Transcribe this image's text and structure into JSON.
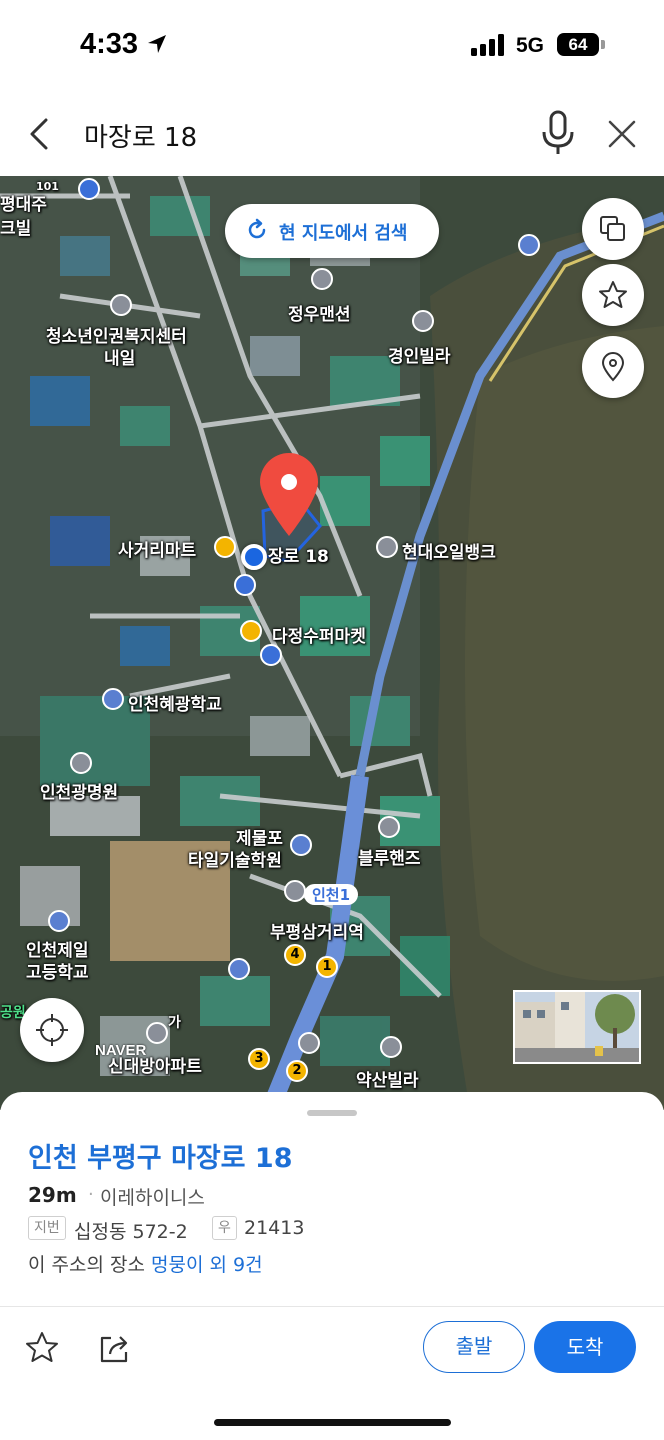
{
  "status_bar": {
    "time": "4:33",
    "network": "5G",
    "battery": "64"
  },
  "search": {
    "query": "마장로 18"
  },
  "map": {
    "search_here_label": "현 지도에서 검색",
    "selected_label": "장로 18",
    "brand": "NAVER",
    "labels": {
      "l1": "평대주",
      "l2": "크빌",
      "l3": "청소년인권복지센터",
      "l4": "내일",
      "l5": "정우맨션",
      "l6": "경인빌라",
      "l7": "사거리마트",
      "l8": "현대오일뱅크",
      "l9": "다정수퍼마켓",
      "l10": "인천혜광학교",
      "l11": "인천광명원",
      "l12": "제물포",
      "l13": "타일기술학원",
      "l14": "블루핸즈",
      "l15": "인천1",
      "l16": "부평삼거리역",
      "l17": "인천제일",
      "l18": "고등학교",
      "l19": "신대방아파트",
      "l20": "약산빌라",
      "l21": "101",
      "l22": "가",
      "l23": "공원"
    },
    "exits": [
      "4",
      "1",
      "3",
      "2"
    ]
  },
  "sheet": {
    "address": "인천 부평구 마장로 18",
    "distance": "29m",
    "separator": "·",
    "place": "이레하이니스",
    "jibun_badge": "지번",
    "jibun": "십정동 572-2",
    "zip_badge": "우",
    "zip": "21413",
    "places_prefix": "이 주소의 장소",
    "places_link": "멍뭉이 외 9건",
    "depart": "출발",
    "arrive": "도착"
  }
}
